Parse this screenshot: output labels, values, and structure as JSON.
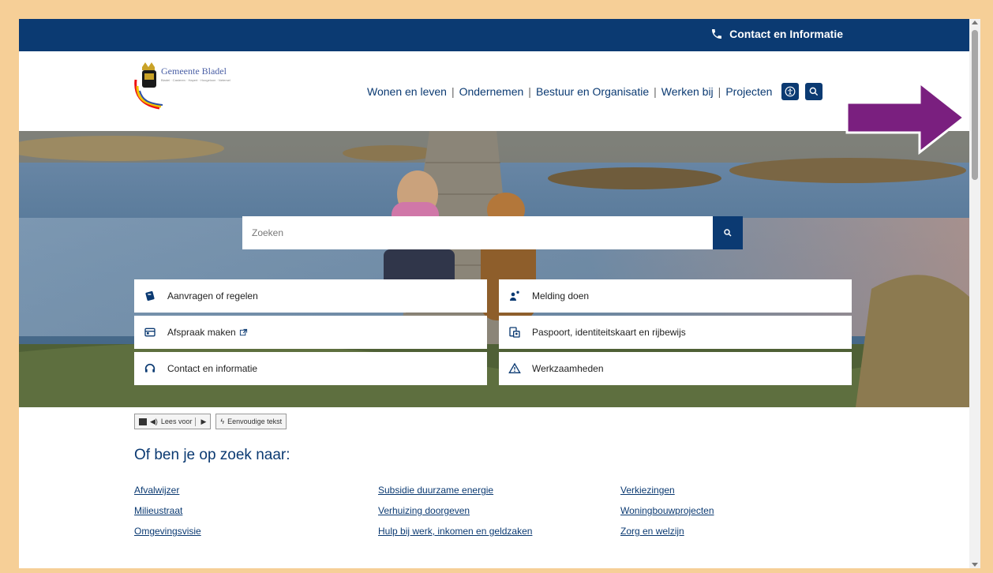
{
  "topbar": {
    "contact_label": "Contact en Informatie"
  },
  "logo": {
    "name": "Gemeente Bladel",
    "tagline": "Bladel · Casteren · Hapert · Hoogeloon · Netersel"
  },
  "nav": {
    "items": [
      "Wonen en leven",
      "Ondernemen",
      "Bestuur en Organisatie",
      "Werken bij",
      "Projecten"
    ]
  },
  "search": {
    "placeholder": "Zoeken"
  },
  "tiles": [
    {
      "label": "Aanvragen of regelen",
      "icon": "document-stack-icon"
    },
    {
      "label": "Melding doen",
      "icon": "person-report-icon"
    },
    {
      "label": "Afspraak maken",
      "icon": "calendar-icon"
    },
    {
      "label": "Paspoort, identiteitskaart en rijbewijs",
      "icon": "id-card-icon"
    },
    {
      "label": "Contact en informatie",
      "icon": "headset-icon"
    },
    {
      "label": "Werkzaamheden",
      "icon": "warning-triangle-icon"
    }
  ],
  "toolbar": {
    "read_label": "Lees voor",
    "simple_label": "Eenvoudige tekst"
  },
  "section": {
    "title": "Of ben je op zoek naar:"
  },
  "links": [
    [
      "Afvalwijzer",
      "Subsidie duurzame energie",
      "Verkiezingen"
    ],
    [
      "Milieustraat",
      "Verhuizing doorgeven",
      "Woningbouwprojecten"
    ],
    [
      "Omgevingsvisie",
      "Hulp bij werk, inkomen en geldzaken",
      "Zorg en welzijn"
    ]
  ],
  "colors": {
    "brand": "#0b3a72",
    "frame": "#f6cf97",
    "arrow": "#7a1f7f"
  }
}
